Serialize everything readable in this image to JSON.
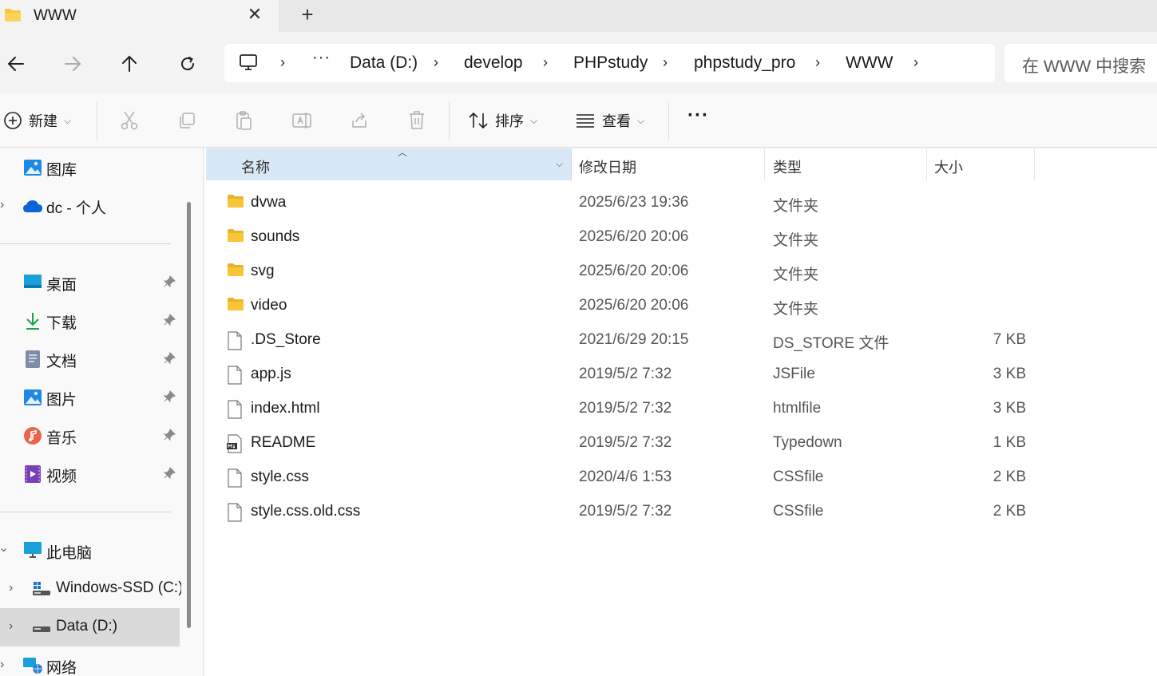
{
  "tab": {
    "title": "WWW",
    "close": "✕",
    "new_tab": "+"
  },
  "nav": {
    "more": "···",
    "breadcrumb": [
      "Data (D:)",
      "develop",
      "PHPstudy",
      "phpstudy_pro",
      "WWW"
    ],
    "sep": "›",
    "search_placeholder": "在 WWW 中搜索"
  },
  "toolbar": {
    "new_label": "新建",
    "sort_label": "排序",
    "view_label": "查看",
    "more": "···"
  },
  "sidebar": {
    "top": [
      {
        "label": "图库",
        "icon": "gallery-icon"
      },
      {
        "label": "dc - 个人",
        "icon": "onedrive-icon"
      }
    ],
    "pinned": [
      {
        "label": "桌面",
        "icon": "desktop-icon"
      },
      {
        "label": "下载",
        "icon": "download-icon"
      },
      {
        "label": "文档",
        "icon": "documents-icon"
      },
      {
        "label": "图片",
        "icon": "pictures-icon"
      },
      {
        "label": "音乐",
        "icon": "music-icon"
      },
      {
        "label": "视频",
        "icon": "videos-icon"
      }
    ],
    "pc": [
      {
        "label": "此电脑",
        "icon": "this-pc-icon"
      },
      {
        "label": "Windows-SSD (C:)",
        "icon": "drive-c-icon"
      },
      {
        "label": "Data (D:)",
        "icon": "drive-d-icon",
        "selected": true
      },
      {
        "label": "网络",
        "icon": "network-icon"
      }
    ]
  },
  "columns": {
    "name": "名称",
    "date": "修改日期",
    "type": "类型",
    "size": "大小"
  },
  "files": [
    {
      "name": "dvwa",
      "date": "2025/6/23 19:36",
      "type": "文件夹",
      "size": "",
      "icon": "folder-icon"
    },
    {
      "name": "sounds",
      "date": "2025/6/20 20:06",
      "type": "文件夹",
      "size": "",
      "icon": "folder-icon"
    },
    {
      "name": "svg",
      "date": "2025/6/20 20:06",
      "type": "文件夹",
      "size": "",
      "icon": "folder-icon"
    },
    {
      "name": "video",
      "date": "2025/6/20 20:06",
      "type": "文件夹",
      "size": "",
      "icon": "folder-icon"
    },
    {
      "name": ".DS_Store",
      "date": "2021/6/29 20:15",
      "type": "DS_STORE 文件",
      "size": "7 KB",
      "icon": "file-icon"
    },
    {
      "name": "app.js",
      "date": "2019/5/2 7:32",
      "type": "JSFile",
      "size": "3 KB",
      "icon": "file-icon"
    },
    {
      "name": "index.html",
      "date": "2019/5/2 7:32",
      "type": "htmlfile",
      "size": "3 KB",
      "icon": "file-icon"
    },
    {
      "name": "README",
      "date": "2019/5/2 7:32",
      "type": "Typedown",
      "size": "1 KB",
      "icon": "markdown-file-icon"
    },
    {
      "name": "style.css",
      "date": "2020/4/6 1:53",
      "type": "CSSfile",
      "size": "2 KB",
      "icon": "file-icon"
    },
    {
      "name": "style.css.old.css",
      "date": "2019/5/2 7:32",
      "type": "CSSfile",
      "size": "2 KB",
      "icon": "file-icon"
    }
  ],
  "colors": {
    "selected_header": "#d9e8f7",
    "folder": "#f8c537",
    "accent": "#0067c0"
  }
}
